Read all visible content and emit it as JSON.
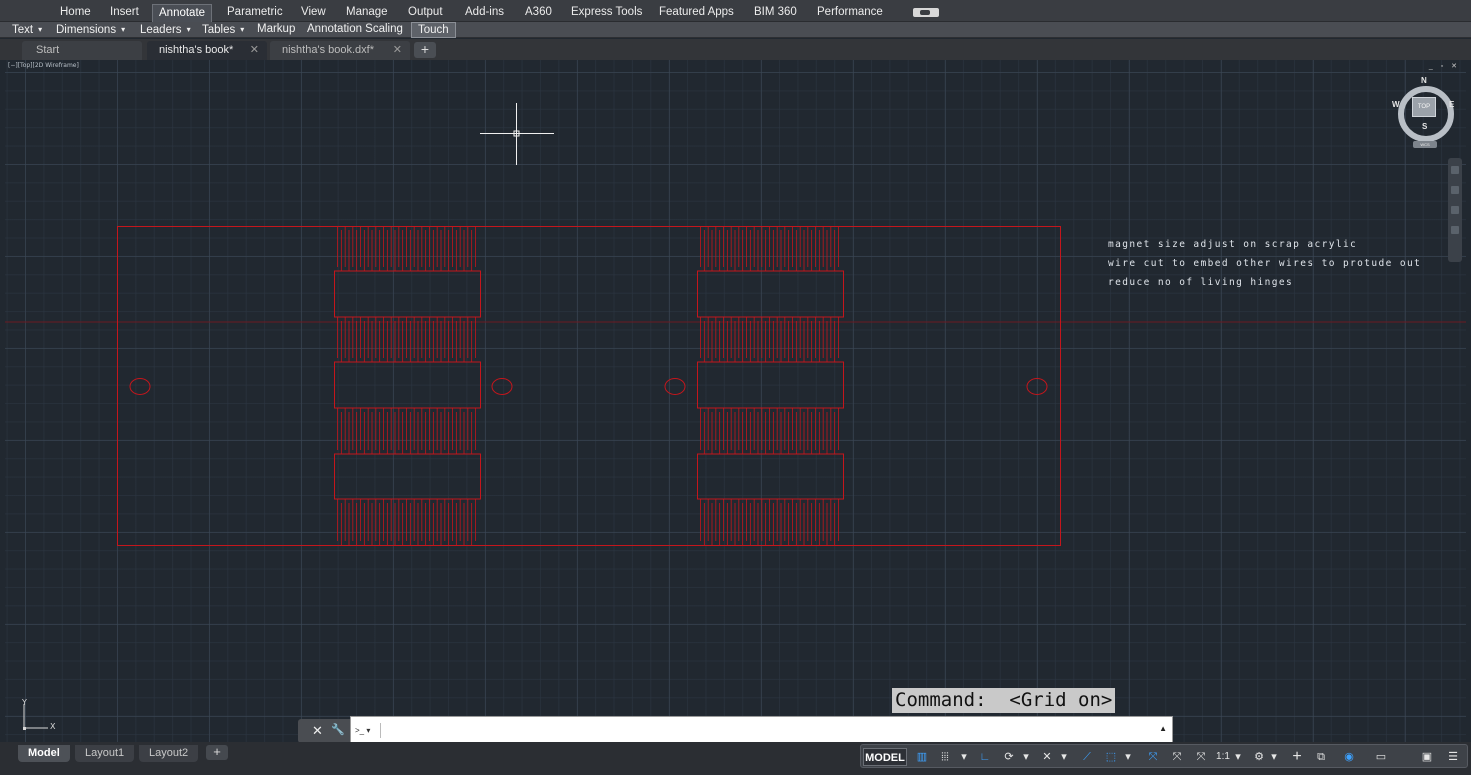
{
  "ribbon": {
    "tabs": [
      "Home",
      "Insert",
      "Annotate",
      "Parametric",
      "View",
      "Manage",
      "Output",
      "Add-ins",
      "A360",
      "Express Tools",
      "Featured Apps",
      "BIM 360",
      "Performance"
    ],
    "active_tab": "Annotate"
  },
  "panels": [
    {
      "label": "Text",
      "arrow": "▾"
    },
    {
      "label": "Dimensions",
      "arrow": "▾"
    },
    {
      "label": "Leaders",
      "arrow": "▾"
    },
    {
      "label": "Tables",
      "arrow": "▾"
    },
    {
      "label": "Markup",
      "arrow": ""
    },
    {
      "label": "Annotation Scaling",
      "arrow": ""
    },
    {
      "label": "Touch",
      "arrow": ""
    }
  ],
  "doc_tabs": [
    {
      "label": "Start",
      "close": ""
    },
    {
      "label": "nishtha's book*",
      "close": "✕"
    },
    {
      "label": "nishtha's book.dxf*",
      "close": "✕"
    }
  ],
  "doc_add": "+",
  "viewport": {
    "label": "[−][Top][2D Wireframe]",
    "controls": "_ ▫ ✕"
  },
  "annotations": [
    "magnet size adjust on scrap acrylic",
    "wire cut to embed other wires to protude out",
    "reduce no of living hinges"
  ],
  "viewcube": {
    "face": "TOP",
    "north": "N",
    "south": "S",
    "east": "E",
    "west": "W",
    "wcs": "WCS"
  },
  "ucs": {
    "x": "X",
    "y": "Y"
  },
  "command": {
    "tooltip": "Command:  <Grid on>",
    "prompt": ">_ ▾",
    "value": "",
    "placeholder": "",
    "history_arrow": "▲",
    "close": "✕",
    "customize": "🔧"
  },
  "layout_tabs": [
    "Model",
    "Layout1",
    "Layout2"
  ],
  "layout_add": "+",
  "status_bar": {
    "model": "MODEL",
    "grid": "▥",
    "snap": "⦙⦙⦙",
    "dd1": "▾",
    "ortho": "∟",
    "polar": "⟳",
    "dd2": "▾",
    "osnap": "✕",
    "dd3": "▾",
    "track": "⟋",
    "select": "⬚",
    "dd4": "▾",
    "anno1": "⤧",
    "anno2": "⤧",
    "anno3": "⤧",
    "scale": "1:1",
    "dd5": "▾",
    "gear": "⚙",
    "dd6": "▾",
    "plus": "+",
    "units": "⧉",
    "iso": "◉",
    "hw": "▭",
    "clean": "▣",
    "menu": "☰"
  },
  "colors": {
    "drawing_line": "#c4161c",
    "axis_line": "#7a1a22",
    "background": "#212830",
    "annotation_text": "#dfe4ea",
    "crosshair": "#ffffff",
    "accent_blue": "#3da2ff"
  }
}
